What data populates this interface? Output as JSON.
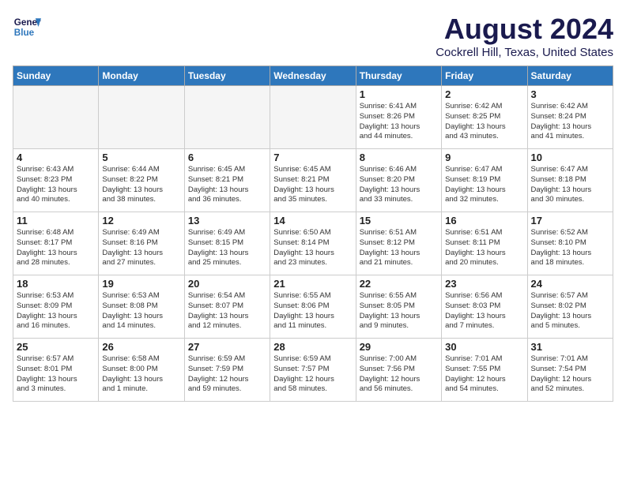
{
  "header": {
    "logo_line1": "General",
    "logo_line2": "Blue",
    "title": "August 2024",
    "subtitle": "Cockrell Hill, Texas, United States"
  },
  "weekdays": [
    "Sunday",
    "Monday",
    "Tuesday",
    "Wednesday",
    "Thursday",
    "Friday",
    "Saturday"
  ],
  "weeks": [
    [
      {
        "day": "",
        "info": ""
      },
      {
        "day": "",
        "info": ""
      },
      {
        "day": "",
        "info": ""
      },
      {
        "day": "",
        "info": ""
      },
      {
        "day": "1",
        "info": "Sunrise: 6:41 AM\nSunset: 8:26 PM\nDaylight: 13 hours\nand 44 minutes."
      },
      {
        "day": "2",
        "info": "Sunrise: 6:42 AM\nSunset: 8:25 PM\nDaylight: 13 hours\nand 43 minutes."
      },
      {
        "day": "3",
        "info": "Sunrise: 6:42 AM\nSunset: 8:24 PM\nDaylight: 13 hours\nand 41 minutes."
      }
    ],
    [
      {
        "day": "4",
        "info": "Sunrise: 6:43 AM\nSunset: 8:23 PM\nDaylight: 13 hours\nand 40 minutes."
      },
      {
        "day": "5",
        "info": "Sunrise: 6:44 AM\nSunset: 8:22 PM\nDaylight: 13 hours\nand 38 minutes."
      },
      {
        "day": "6",
        "info": "Sunrise: 6:45 AM\nSunset: 8:21 PM\nDaylight: 13 hours\nand 36 minutes."
      },
      {
        "day": "7",
        "info": "Sunrise: 6:45 AM\nSunset: 8:21 PM\nDaylight: 13 hours\nand 35 minutes."
      },
      {
        "day": "8",
        "info": "Sunrise: 6:46 AM\nSunset: 8:20 PM\nDaylight: 13 hours\nand 33 minutes."
      },
      {
        "day": "9",
        "info": "Sunrise: 6:47 AM\nSunset: 8:19 PM\nDaylight: 13 hours\nand 32 minutes."
      },
      {
        "day": "10",
        "info": "Sunrise: 6:47 AM\nSunset: 8:18 PM\nDaylight: 13 hours\nand 30 minutes."
      }
    ],
    [
      {
        "day": "11",
        "info": "Sunrise: 6:48 AM\nSunset: 8:17 PM\nDaylight: 13 hours\nand 28 minutes."
      },
      {
        "day": "12",
        "info": "Sunrise: 6:49 AM\nSunset: 8:16 PM\nDaylight: 13 hours\nand 27 minutes."
      },
      {
        "day": "13",
        "info": "Sunrise: 6:49 AM\nSunset: 8:15 PM\nDaylight: 13 hours\nand 25 minutes."
      },
      {
        "day": "14",
        "info": "Sunrise: 6:50 AM\nSunset: 8:14 PM\nDaylight: 13 hours\nand 23 minutes."
      },
      {
        "day": "15",
        "info": "Sunrise: 6:51 AM\nSunset: 8:12 PM\nDaylight: 13 hours\nand 21 minutes."
      },
      {
        "day": "16",
        "info": "Sunrise: 6:51 AM\nSunset: 8:11 PM\nDaylight: 13 hours\nand 20 minutes."
      },
      {
        "day": "17",
        "info": "Sunrise: 6:52 AM\nSunset: 8:10 PM\nDaylight: 13 hours\nand 18 minutes."
      }
    ],
    [
      {
        "day": "18",
        "info": "Sunrise: 6:53 AM\nSunset: 8:09 PM\nDaylight: 13 hours\nand 16 minutes."
      },
      {
        "day": "19",
        "info": "Sunrise: 6:53 AM\nSunset: 8:08 PM\nDaylight: 13 hours\nand 14 minutes."
      },
      {
        "day": "20",
        "info": "Sunrise: 6:54 AM\nSunset: 8:07 PM\nDaylight: 13 hours\nand 12 minutes."
      },
      {
        "day": "21",
        "info": "Sunrise: 6:55 AM\nSunset: 8:06 PM\nDaylight: 13 hours\nand 11 minutes."
      },
      {
        "day": "22",
        "info": "Sunrise: 6:55 AM\nSunset: 8:05 PM\nDaylight: 13 hours\nand 9 minutes."
      },
      {
        "day": "23",
        "info": "Sunrise: 6:56 AM\nSunset: 8:03 PM\nDaylight: 13 hours\nand 7 minutes."
      },
      {
        "day": "24",
        "info": "Sunrise: 6:57 AM\nSunset: 8:02 PM\nDaylight: 13 hours\nand 5 minutes."
      }
    ],
    [
      {
        "day": "25",
        "info": "Sunrise: 6:57 AM\nSunset: 8:01 PM\nDaylight: 13 hours\nand 3 minutes."
      },
      {
        "day": "26",
        "info": "Sunrise: 6:58 AM\nSunset: 8:00 PM\nDaylight: 13 hours\nand 1 minute."
      },
      {
        "day": "27",
        "info": "Sunrise: 6:59 AM\nSunset: 7:59 PM\nDaylight: 12 hours\nand 59 minutes."
      },
      {
        "day": "28",
        "info": "Sunrise: 6:59 AM\nSunset: 7:57 PM\nDaylight: 12 hours\nand 58 minutes."
      },
      {
        "day": "29",
        "info": "Sunrise: 7:00 AM\nSunset: 7:56 PM\nDaylight: 12 hours\nand 56 minutes."
      },
      {
        "day": "30",
        "info": "Sunrise: 7:01 AM\nSunset: 7:55 PM\nDaylight: 12 hours\nand 54 minutes."
      },
      {
        "day": "31",
        "info": "Sunrise: 7:01 AM\nSunset: 7:54 PM\nDaylight: 12 hours\nand 52 minutes."
      }
    ]
  ]
}
